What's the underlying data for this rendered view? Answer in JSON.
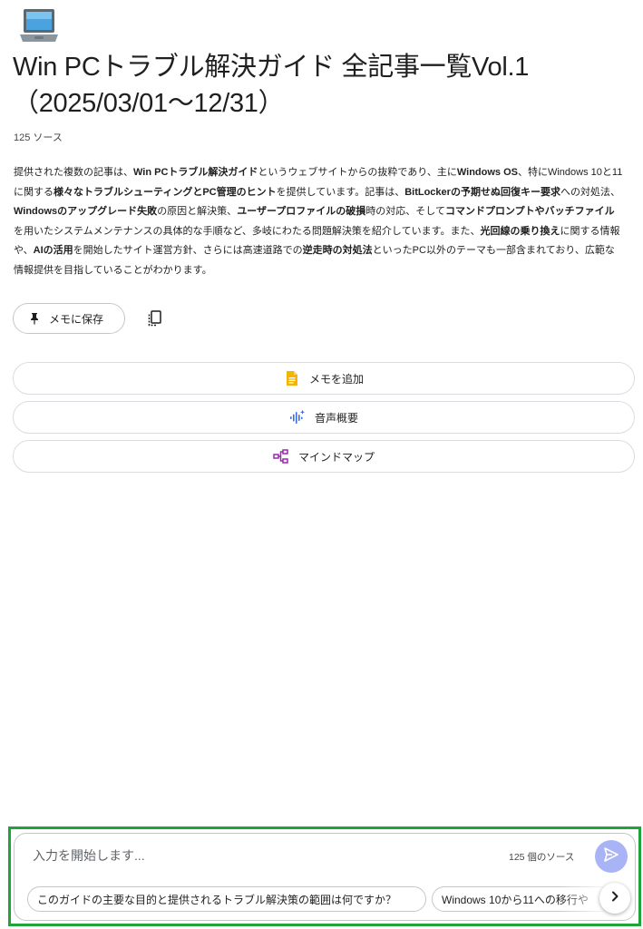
{
  "header": {
    "emoji_icon": "laptop-icon",
    "title": "Win PCトラブル解決ガイド 全記事一覧Vol.1（2025/03/01〜12/31）",
    "source_count": "125 ソース"
  },
  "summary": {
    "segments": [
      {
        "text": "提供された複数の記事は、",
        "bold": false
      },
      {
        "text": "Win PCトラブル解決ガイド",
        "bold": true
      },
      {
        "text": "というウェブサイトからの抜粋であり、主に",
        "bold": false
      },
      {
        "text": "Windows OS",
        "bold": true
      },
      {
        "text": "、特にWindows 10と11に関する",
        "bold": false
      },
      {
        "text": "様々なトラブルシューティングとPC管理のヒント",
        "bold": true
      },
      {
        "text": "を提供しています。記事は、",
        "bold": false
      },
      {
        "text": "BitLockerの予期せぬ回復キー要求",
        "bold": true
      },
      {
        "text": "への対処法、",
        "bold": false
      },
      {
        "text": "Windowsのアップグレード失敗",
        "bold": true
      },
      {
        "text": "の原因と解決策、",
        "bold": false
      },
      {
        "text": "ユーザープロファイルの破損",
        "bold": true
      },
      {
        "text": "時の対応、そして",
        "bold": false
      },
      {
        "text": "コマンドプロンプトやバッチファイル",
        "bold": true
      },
      {
        "text": "を用いたシステムメンテナンスの具体的な手順など、多岐にわたる問題解決策を紹介しています。また、",
        "bold": false
      },
      {
        "text": "光回線の乗り換え",
        "bold": true
      },
      {
        "text": "に関する情報や、",
        "bold": false
      },
      {
        "text": "AIの活用",
        "bold": true
      },
      {
        "text": "を開始したサイト運営方針、さらには高速道路での",
        "bold": false
      },
      {
        "text": "逆走時の対処法",
        "bold": true
      },
      {
        "text": "といったPC以外のテーマも一部含まれており、広範な情報提供を目指していることがわかります。",
        "bold": false
      }
    ]
  },
  "actions": {
    "save_note_label": "メモに保存",
    "save_note_icon": "pin-icon",
    "copy_icon": "copy-icon",
    "add_note_label": "メモを追加",
    "add_note_icon": "note-icon",
    "audio_overview_label": "音声概要",
    "audio_overview_icon": "audio-wave-icon",
    "mindmap_label": "マインドマップ",
    "mindmap_icon": "mindmap-icon"
  },
  "chat": {
    "placeholder": "入力を開始します...",
    "source_count": "125 個のソース",
    "send_icon": "send-icon",
    "suggestions": [
      "このガイドの主要な目的と提供されるトラブル解決策の範囲は何ですか？",
      "Windows 10から11への移行や"
    ],
    "next_icon": "chevron-right-icon"
  },
  "colors": {
    "highlight_border": "#1fa33a",
    "send_button": "#a8b4f5",
    "note_icon": "#f5b400",
    "audio_icon": "#3b6fe0",
    "mindmap_icon": "#9c27b0"
  }
}
